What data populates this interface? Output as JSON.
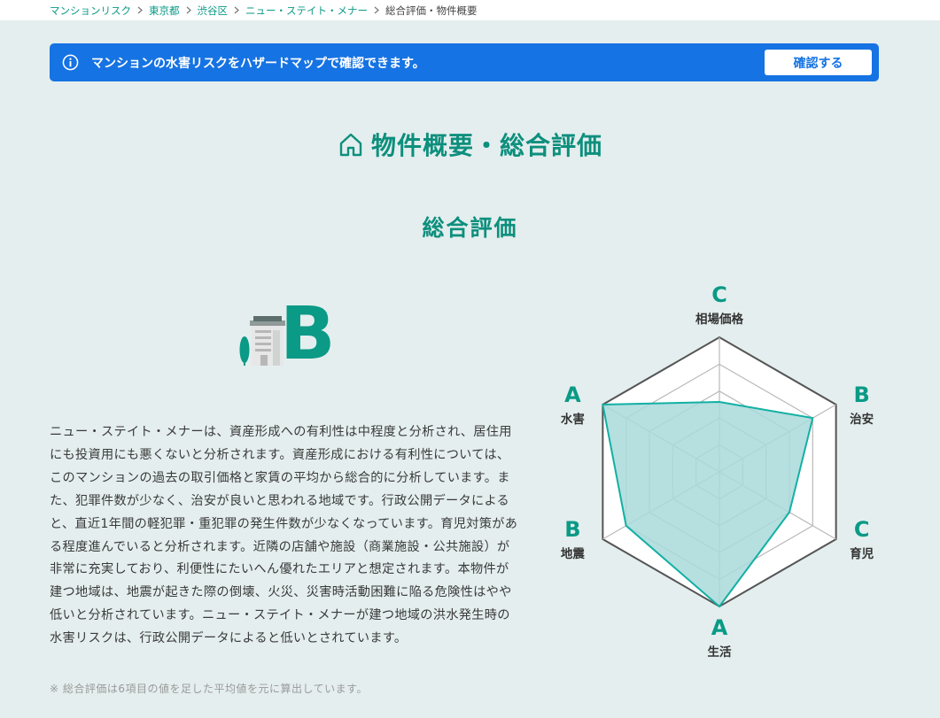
{
  "breadcrumb": {
    "items": [
      "マンションリスク",
      "東京都",
      "渋谷区",
      "ニュー・ステイト・メナー"
    ],
    "current": "総合評価・物件概要"
  },
  "banner": {
    "text": "マンションの水害リスクをハザードマップで確認できます。",
    "button_label": "確認する",
    "icon": "info-icon"
  },
  "section": {
    "title": "物件概要・総合評価",
    "icon": "house-icon"
  },
  "overall": {
    "heading": "総合評価",
    "grade": "B",
    "description": "ニュー・ステイト・メナーは、資産形成への有利性は中程度と分析され、居住用にも投資用にも悪くないと分析されます。資産形成における有利性については、このマンションの過去の取引価格と家賃の平均から総合的に分析しています。また、犯罪件数が少なく、治安が良いと思われる地域です。行政公開データによると、直近1年間の軽犯罪・重犯罪の発生件数が少なくなっています。育児対策がある程度進んでいると分析されます。近隣の店舗や施設（商業施設・公共施設）が非常に充実しており、利便性にたいへん優れたエリアと想定されます。本物件が建つ地域は、地震が起きた際の倒壊、火災、災害時活動困難に陥る危険性はやや低いと分析されています。ニュー・ステイト・メナーが建つ地域の洪水発生時の水害リスクは、行政公開データによると低いとされています。",
    "note": "※ 総合評価は6項目の値を足した平均値を元に算出しています。"
  },
  "radar": {
    "axes": [
      {
        "label": "相場価格",
        "grade": "C",
        "value": 0.52
      },
      {
        "label": "治安",
        "grade": "B",
        "value": 0.8
      },
      {
        "label": "育児",
        "grade": "C",
        "value": 0.6
      },
      {
        "label": "生活",
        "grade": "A",
        "value": 1.0
      },
      {
        "label": "地震",
        "grade": "B",
        "value": 0.8
      },
      {
        "label": "水害",
        "grade": "A",
        "value": 1.0
      }
    ],
    "colors": {
      "fill": "#a9d9da",
      "stroke": "#13b0a4",
      "grade": "#0a9a86",
      "outer": "#555555",
      "grid": "#b9b9b9"
    }
  }
}
